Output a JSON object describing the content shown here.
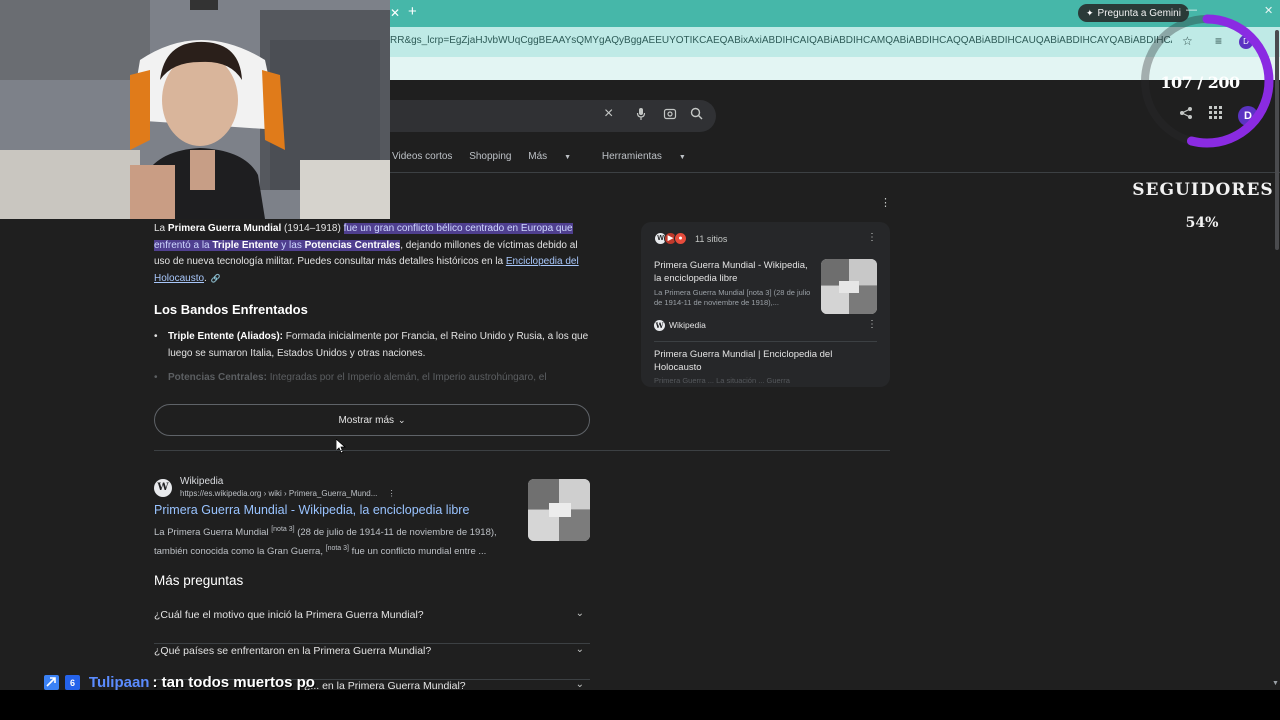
{
  "browser": {
    "url": "RR&gs_lcrp=EgZjaHJvbWUqCggBEAAYsQMYgAQyBggAEEUYOTIKCAEQABixAxiABDIHCAIQABiABDIHCAMQABiABDIHCAQQABiABDIHCAUQABiABDIHCAYQABiABDIHCAcQABiABDIHCAgQA...",
    "gemini_label": "Pregunta a Gemini",
    "tab_close": "✕",
    "tab_new": "+",
    "profile_initial": "D"
  },
  "search": {
    "filters": [
      "Videos cortos",
      "Shopping",
      "Más",
      "Herramientas"
    ]
  },
  "overlay": {
    "counter": "107 / 200",
    "followers_label": "SEGUIDORES",
    "followers_pct": "54%",
    "progress": 0.54
  },
  "ai_overview": {
    "intro_pre": "La ",
    "intro_bold": "Primera Guerra Mundial",
    "intro_years": " (1914–1918) ",
    "intro_hl_1": "fue un gran conflicto bélico centrado en Europa que enfrentó a la ",
    "intro_hl_bold1": "Triple Entente",
    "intro_hl_2": " y las ",
    "intro_hl_bold2": "Potencias Centrales",
    "intro_rest": ", dejando millones de víctimas debido al uso de nueva tecnología militar. Puedes consultar más detalles históricos en la ",
    "intro_link": "Enciclopedia del Holocausto",
    "intro_end": ".",
    "section_title": "Los Bandos Enfrentados",
    "bullet1_bold": "Triple Entente (Aliados):",
    "bullet1_text": " Formada inicialmente por Francia, el Reino Unido y Rusia, a los que luego se sumaron Italia, Estados Unidos y otras naciones.",
    "bullet2_bold": "Potencias Centrales:",
    "bullet2_text": " Integradas por el Imperio alemán, el Imperio austrohúngaro, el",
    "show_more": "Mostrar más"
  },
  "sources_panel": {
    "count": "11 sitios",
    "item1_title": "Primera Guerra Mundial - Wikipedia, la enciclopedia libre",
    "item1_snippet": "La Primera Guerra Mundial [nota 3] (28 de julio de 1914-11 de noviembre de 1918),...",
    "item1_source": "Wikipedia",
    "item2_title": "Primera Guerra Mundial | Enciclopedia del Holocausto",
    "item2_fade": "Primera Guerra ... La situación ... Guerra"
  },
  "result": {
    "site": "Wikipedia",
    "url": "https://es.wikipedia.org › wiki › Primera_Guerra_Mund...",
    "title": "Primera Guerra Mundial - Wikipedia, la enciclopedia libre",
    "snippet_1": "La Primera Guerra Mundial ",
    "sup_1": "[nota 3]",
    "snippet_2": " (28 de julio de 1914-11 de noviembre de 1918), también conocida como la Gran Guerra, ",
    "sup_2": "[nota 3]",
    "snippet_3": " fue un conflicto mundial entre ..."
  },
  "more_questions": {
    "title": "Más preguntas",
    "items": [
      "¿Cuál fue el motivo que inició la Primera Guerra Mundial?",
      "¿Qué países se enfrentaron en la Primera Guerra Mundial?",
      "¿... en la Primera Guerra Mundial?"
    ]
  },
  "chat": {
    "user": "Tulipaan",
    "message": ": tan todos muertos po"
  },
  "colors": {
    "tab_strip": "#46b7a9",
    "address_bar": "#bfeae6",
    "page_bg": "#1f1f1f",
    "highlight": "#4f3f8f",
    "link": "#99c3ff",
    "progress_ring": "#8a2be2"
  },
  "icons": [
    "close-icon",
    "plus-icon",
    "sparkle-icon",
    "star-icon",
    "mic-icon",
    "lens-icon",
    "search-icon",
    "share-icon",
    "apps-grid-icon",
    "kebab-icon",
    "chevron-down-icon",
    "link-icon",
    "cursor-icon"
  ]
}
